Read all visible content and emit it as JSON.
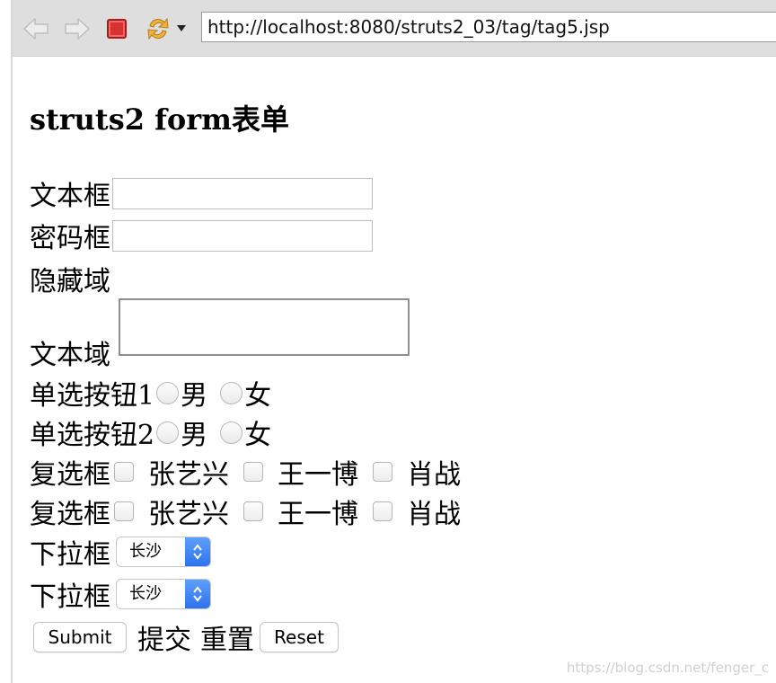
{
  "browser": {
    "url": "http://localhost:8080/struts2_03/tag/tag5.jsp",
    "icons": [
      "back-arrow-icon",
      "forward-arrow-icon",
      "stop-icon",
      "reload-icon",
      "dropdown-caret-icon"
    ]
  },
  "page": {
    "title": "struts2 form表单"
  },
  "form": {
    "text_label": "文本框",
    "password_label": "密码框",
    "hidden_label": "隐藏域",
    "textarea_label": "文本域",
    "radio1": {
      "label": "单选按钮1",
      "options": [
        "男",
        "女"
      ]
    },
    "radio2": {
      "label": "单选按钮2",
      "options": [
        "男",
        "女"
      ]
    },
    "checkbox1": {
      "label": "复选框",
      "options": [
        "张艺兴",
        "王一博",
        "肖战"
      ]
    },
    "checkbox2": {
      "label": "复选框",
      "options": [
        "张艺兴",
        "王一博",
        "肖战"
      ]
    },
    "select1": {
      "label": "下拉框",
      "value": "长沙"
    },
    "select2": {
      "label": "下拉框",
      "value": "长沙"
    },
    "submit_button": "Submit",
    "submit_text": "提交",
    "reset_text": "重置",
    "reset_button": "Reset"
  },
  "watermark": "https://blog.csdn.net/fenger_c",
  "colors": {
    "toolbar_bg": "#dedede",
    "stop_red": "#d8302e",
    "reload_orange": "#e8a431",
    "select_blue": "#2d72ee"
  }
}
